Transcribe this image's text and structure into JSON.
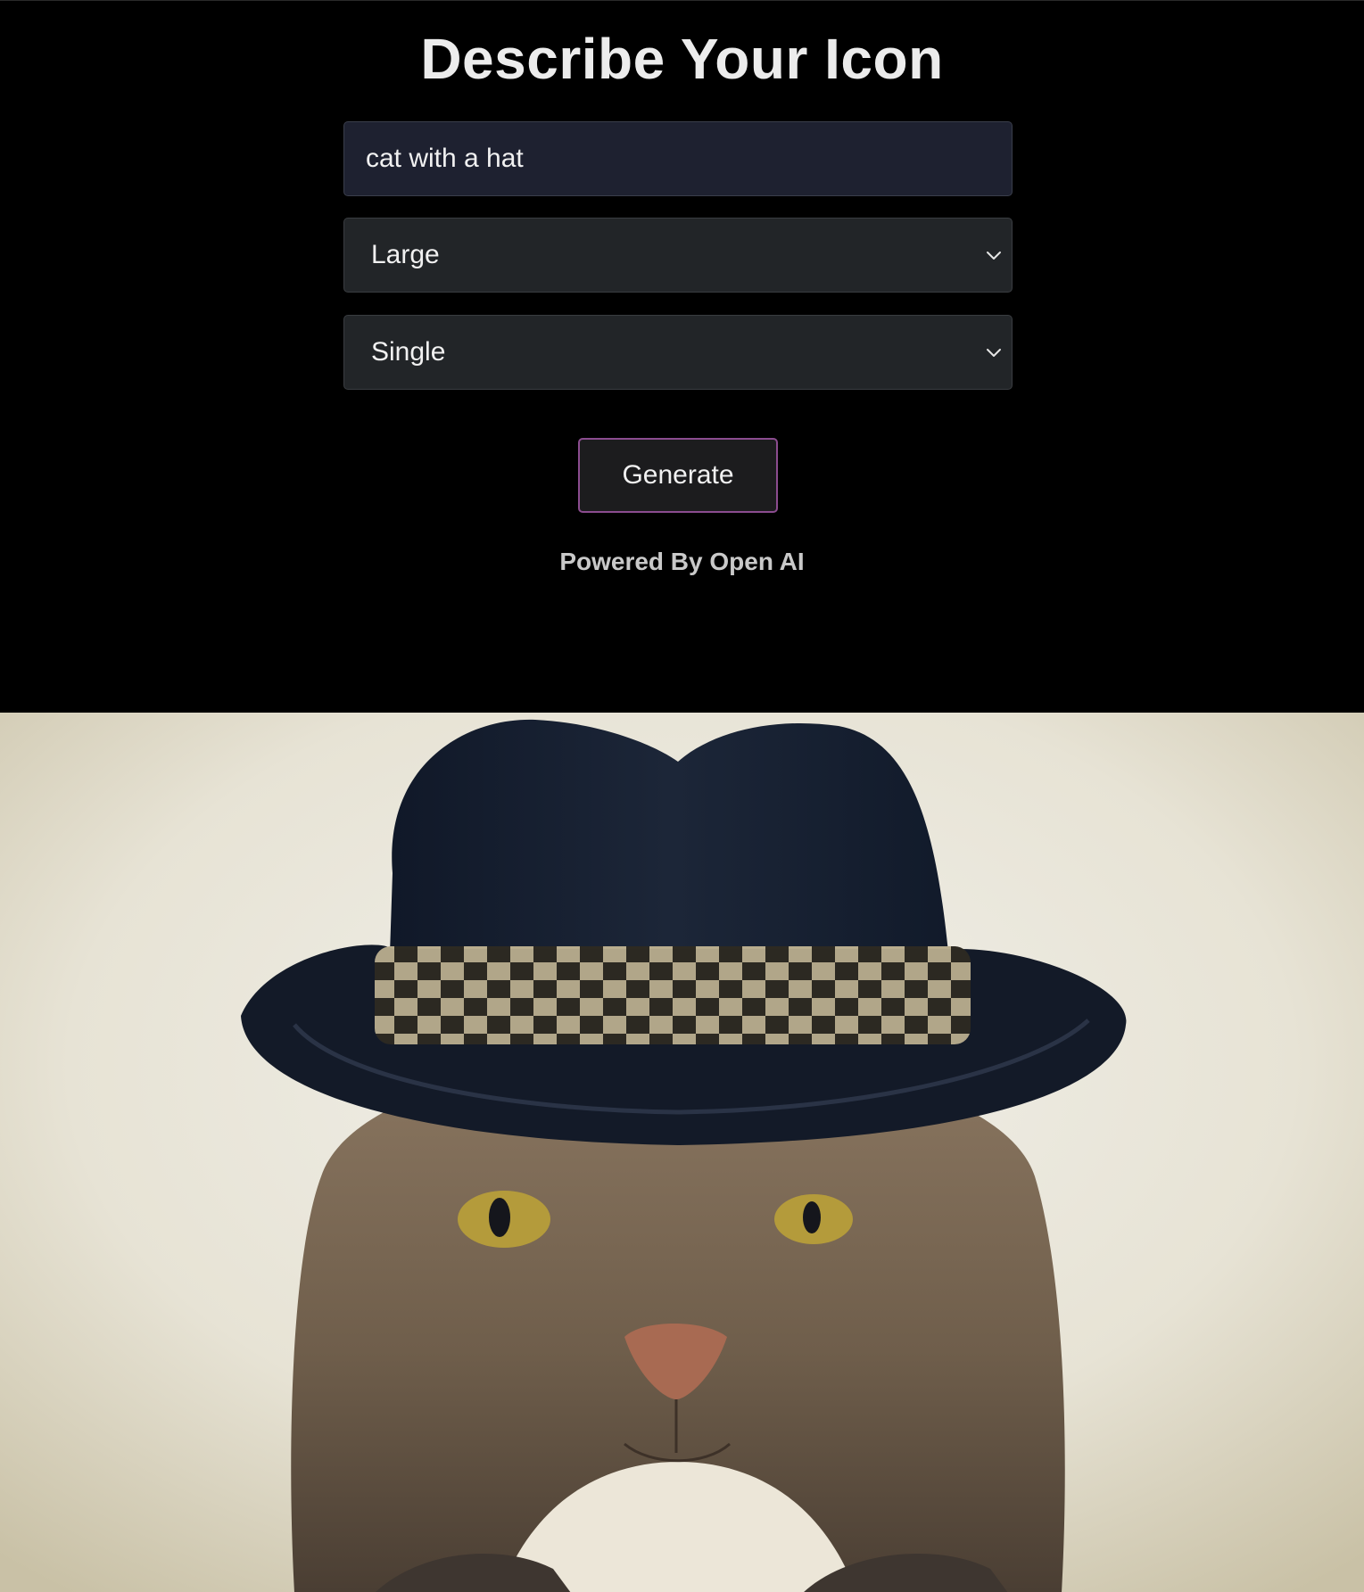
{
  "header": {
    "title": "Describe Your Icon"
  },
  "form": {
    "prompt_value": "cat with a hat",
    "size_select": {
      "selected": "Large"
    },
    "count_select": {
      "selected": "Single"
    },
    "generate_label": "Generate",
    "powered_by": "Powered By Open AI"
  },
  "result": {
    "image_alt": "cat with a hat"
  },
  "colors": {
    "background": "#000000",
    "input_bg": "#1e2130",
    "select_bg": "#222528",
    "button_border": "#8b4c8f",
    "text": "#f1f1f1"
  }
}
